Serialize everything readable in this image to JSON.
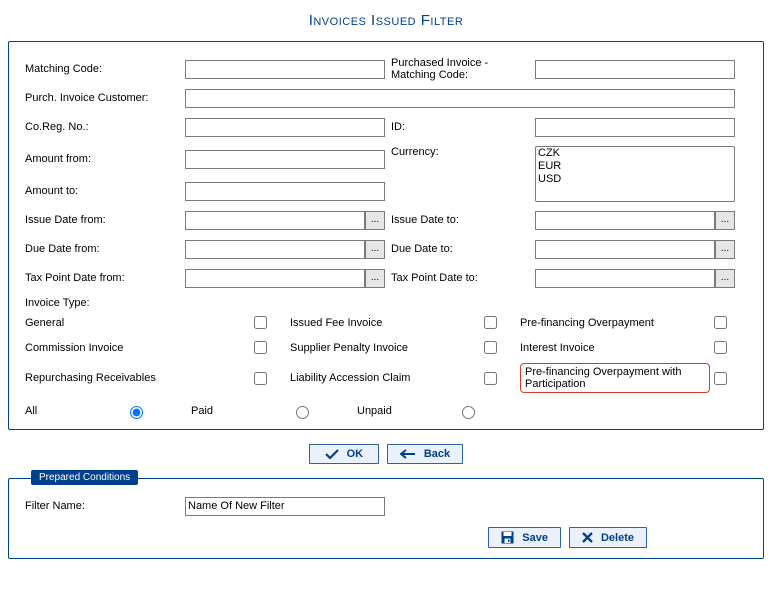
{
  "title": "Invoices Issued Filter",
  "labels": {
    "matching_code": "Matching Code:",
    "purchased_invoice_mc": "Purchased Invoice - Matching Code:",
    "purch_invoice_customer": "Purch. Invoice Customer:",
    "co_reg_no": "Co.Reg. No.:",
    "id": "ID:",
    "amount_from": "Amount from:",
    "currency": "Currency:",
    "amount_to": "Amount to:",
    "issue_from": "Issue Date from:",
    "issue_to": "Issue Date to:",
    "due_from": "Due Date from:",
    "due_to": "Due Date to:",
    "tax_from": "Tax Point Date from:",
    "tax_to": "Tax Point Date to:",
    "invoice_type": "Invoice Type:",
    "filter_name": "Filter Name:"
  },
  "currency_options": [
    "CZK",
    "EUR",
    "USD"
  ],
  "check": {
    "general": "General",
    "issued_fee": "Issued Fee Invoice",
    "prefin_over": "Pre-financing Overpayment",
    "commission": "Commission Invoice",
    "supplier_penalty": "Supplier Penalty Invoice",
    "interest": "Interest Invoice",
    "repurch": "Repurchasing Receivables",
    "liability": "Liability Accession Claim",
    "prefin_over_part": "Pre-financing Overpayment with Participation"
  },
  "radio": {
    "all": "All",
    "paid": "Paid",
    "unpaid": "Unpaid"
  },
  "buttons": {
    "ok": "OK",
    "back": "Back",
    "save": "Save",
    "delete": "Delete"
  },
  "prepared_legend": "Prepared Conditions",
  "filter_name_value": "Name Of New Filter",
  "ellipsis": "..."
}
